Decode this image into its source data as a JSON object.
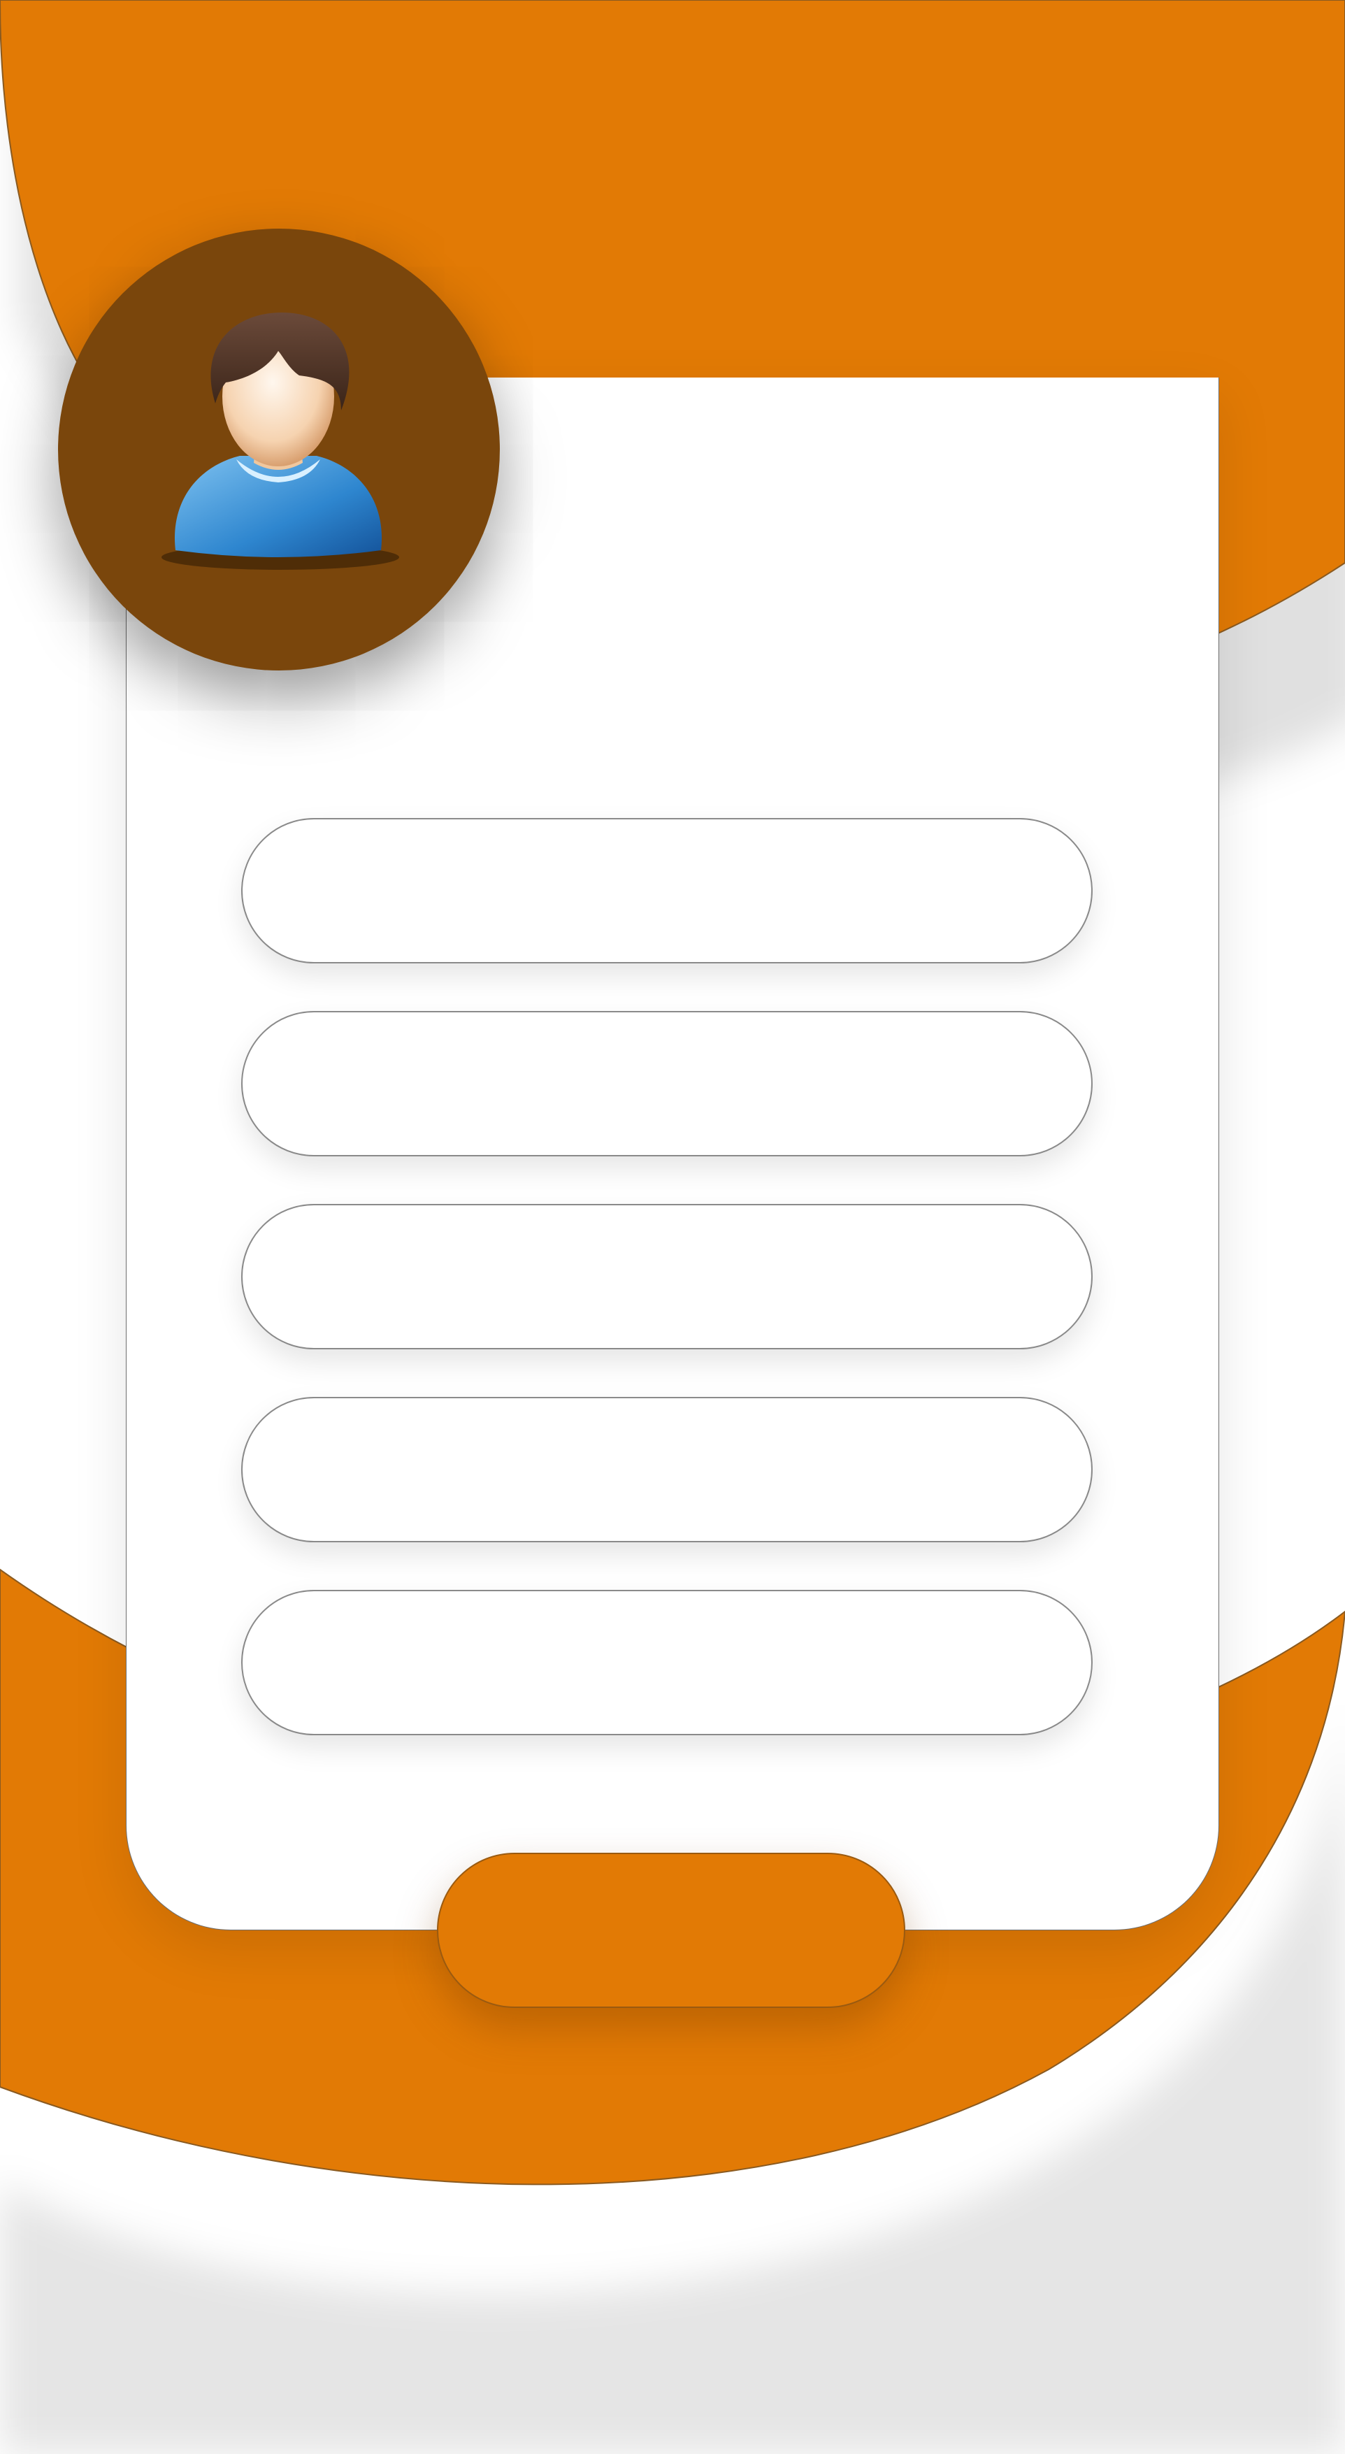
{
  "theme": {
    "accent": "#e27a05",
    "accent_dark": "#7a460c",
    "card_bg": "#ffffff",
    "field_border": "#8a8a8a"
  },
  "avatar": {
    "icon": "user-icon"
  },
  "form": {
    "fields": [
      {
        "value": "",
        "placeholder": ""
      },
      {
        "value": "",
        "placeholder": ""
      },
      {
        "value": "",
        "placeholder": ""
      },
      {
        "value": "",
        "placeholder": ""
      },
      {
        "value": "",
        "placeholder": ""
      }
    ],
    "submit_label": ""
  }
}
